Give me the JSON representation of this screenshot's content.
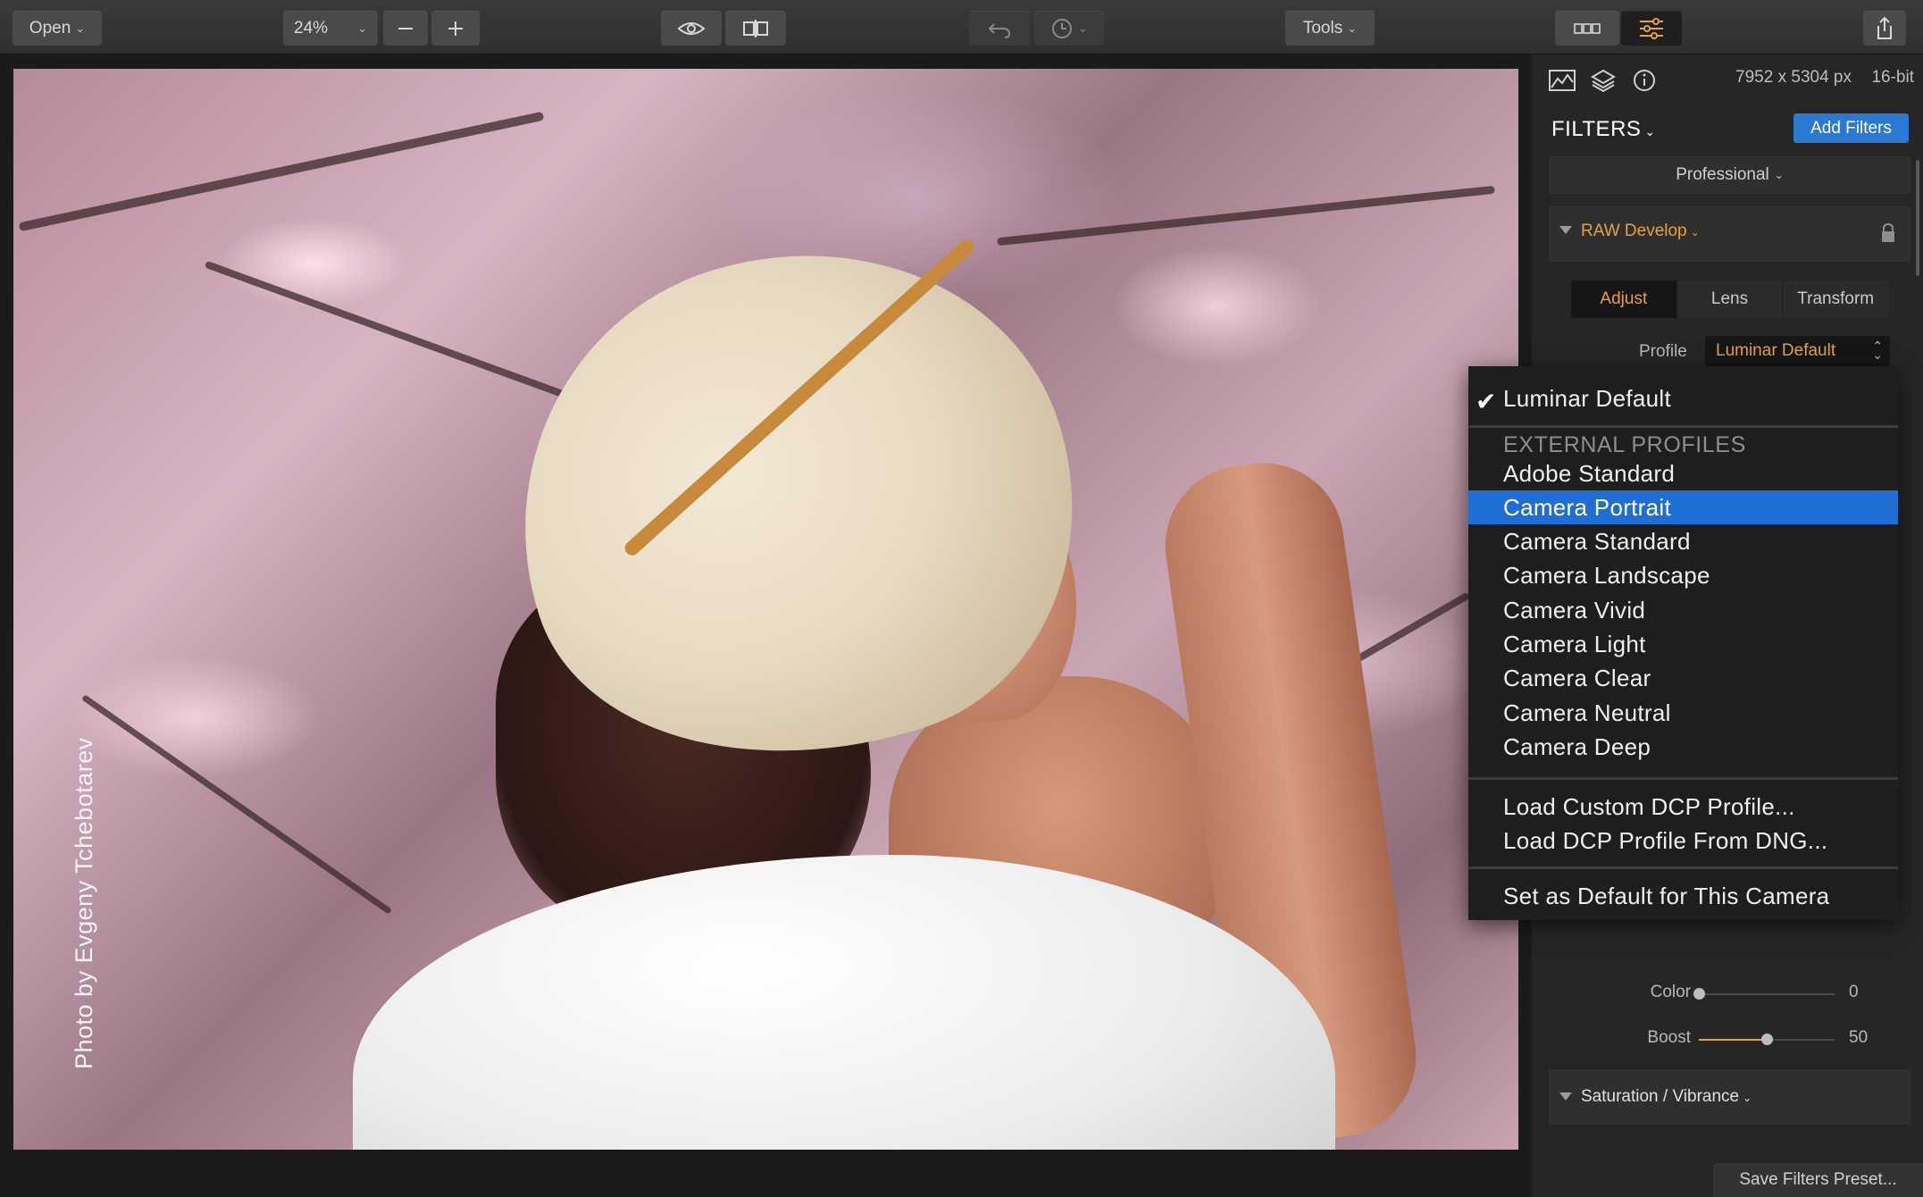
{
  "toolbar": {
    "open_label": "Open",
    "zoom_value": "24%"
  },
  "tools_label": "Tools",
  "photo": {
    "credit": "Photo by Evgeny Tchebotarev"
  },
  "panel": {
    "dimensions": "7952 x 5304 px",
    "bit_depth": "16-bit",
    "filters_title": "FILTERS",
    "add_filters_label": "Add Filters",
    "workspace_label": "Professional",
    "raw_develop": {
      "title": "RAW Develop",
      "tabs": [
        {
          "label": "Adjust",
          "active": true
        },
        {
          "label": "Lens",
          "active": false
        },
        {
          "label": "Transform",
          "active": false
        }
      ],
      "profile_label": "Profile",
      "profile_value": "Luminar Default",
      "sliders": [
        {
          "label": "Color",
          "value": "0",
          "fraction": 0.0
        },
        {
          "label": "Boost",
          "value": "50",
          "fraction": 0.5
        }
      ]
    },
    "saturation_title": "Saturation / Vibrance",
    "save_preset_label": "Save Filters Preset..."
  },
  "dropdown": {
    "checked_item": "Luminar Default",
    "section_header": "EXTERNAL PROFILES",
    "profiles": [
      "Adobe Standard",
      "Camera Portrait",
      "Camera Standard",
      "Camera Landscape",
      "Camera Vivid",
      "Camera Light",
      "Camera Clear",
      "Camera Neutral",
      "Camera Deep"
    ],
    "highlighted": "Camera Portrait",
    "load_custom": "Load Custom DCP Profile...",
    "load_from_dng": "Load DCP Profile From DNG...",
    "set_default": "Set as Default for This Camera"
  },
  "colors": {
    "accent_orange": "#e6a23c",
    "selection_blue": "#1f6ed4",
    "button_blue": "#2a79d3"
  }
}
